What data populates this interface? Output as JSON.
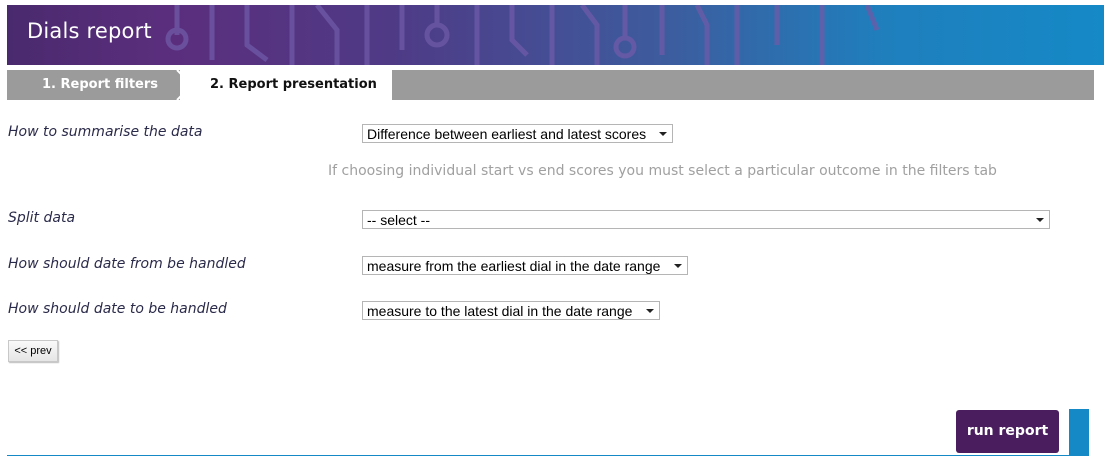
{
  "header": {
    "title": "Dials report"
  },
  "tabs": [
    {
      "label": "1. Report filters",
      "active": false
    },
    {
      "label": "2. Report presentation",
      "active": true
    }
  ],
  "form": {
    "summarise": {
      "label": "How to summarise the data",
      "value": "Difference between earliest and latest scores"
    },
    "hint": "If choosing individual start vs end scores you must select a particular outcome in the filters tab",
    "split": {
      "label": "Split data",
      "value": "-- select --"
    },
    "date_from": {
      "label": "How should date from be handled",
      "value": "measure from the earliest dial in the date range"
    },
    "date_to": {
      "label": "How should date to be handled",
      "value": "measure to the latest dial in the date range"
    }
  },
  "buttons": {
    "prev": "<< prev",
    "run": "run report"
  },
  "colors": {
    "brand_purple": "#4a1d5e",
    "brand_blue": "#1589c6",
    "tab_grey": "#9b9b9b"
  }
}
